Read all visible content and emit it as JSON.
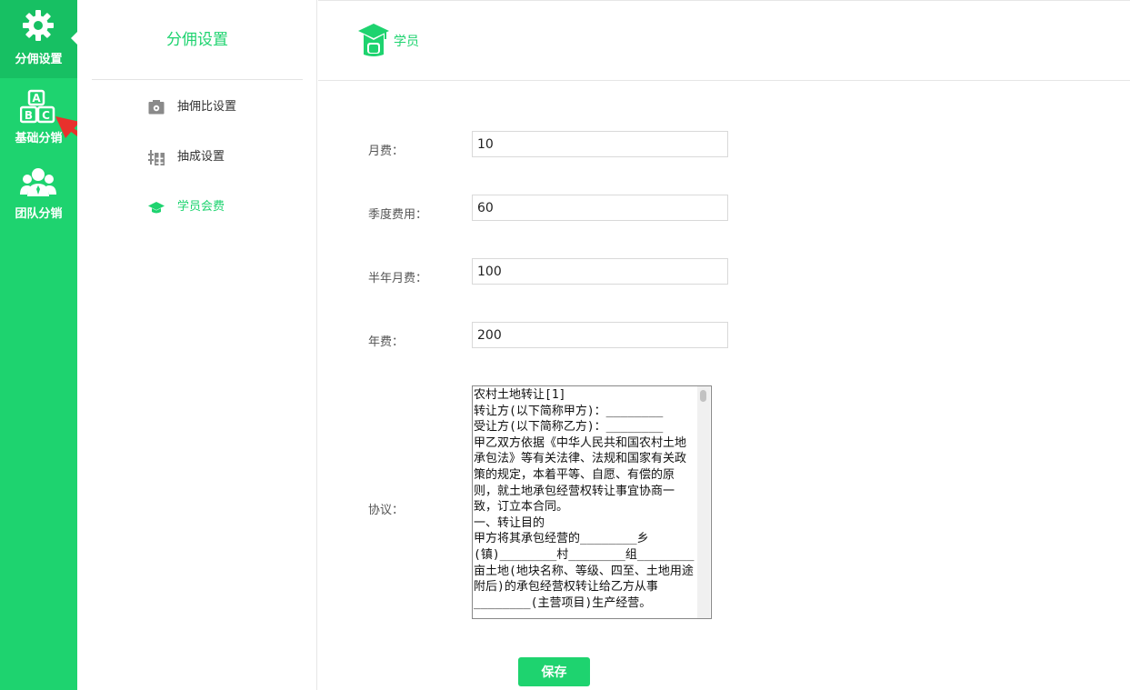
{
  "nav": {
    "items": [
      {
        "label": "分佣设置",
        "icon": "gear-icon"
      },
      {
        "label": "基础分销",
        "icon": "abc-blocks-icon"
      },
      {
        "label": "团队分销",
        "icon": "team-icon"
      }
    ]
  },
  "submenu": {
    "title": "分佣设置",
    "items": [
      {
        "label": "抽佣比设置",
        "icon": "camera-gear-icon"
      },
      {
        "label": "抽成设置",
        "icon": "chou-glyph-icon"
      },
      {
        "label": "学员会费",
        "icon": "graduation-cap-icon"
      }
    ]
  },
  "header": {
    "title": "学员",
    "icon": "student-graduation-icon"
  },
  "form": {
    "monthly_label": "月费：",
    "monthly_value": "10",
    "quarterly_label": "季度费用：",
    "quarterly_value": "60",
    "halfyear_label": "半年月费：",
    "halfyear_value": "100",
    "yearly_label": "年费：",
    "yearly_value": "200",
    "agreement_label": "协议：",
    "agreement_text": "农村土地转让[1]\n转让方(以下简称甲方)：________\n受让方(以下简称乙方)：________\n甲乙双方依据《中华人民共和国农村土地承包法》等有关法律、法规和国家有关政策的规定，本着平等、自愿、有偿的原则，就土地承包经营权转让事宜协商一致，订立本合同。\n一、转让目的\n甲方将其承包经营的________乡(镇)________村________组________亩土地(地块名称、等级、四至、土地用途附后)的承包经营权转让给乙方从事________(主营项目)生产经营。",
    "save_label": "保存"
  },
  "colors": {
    "primary_green": "#1ed36f",
    "annotation_red": "#e8312c"
  }
}
